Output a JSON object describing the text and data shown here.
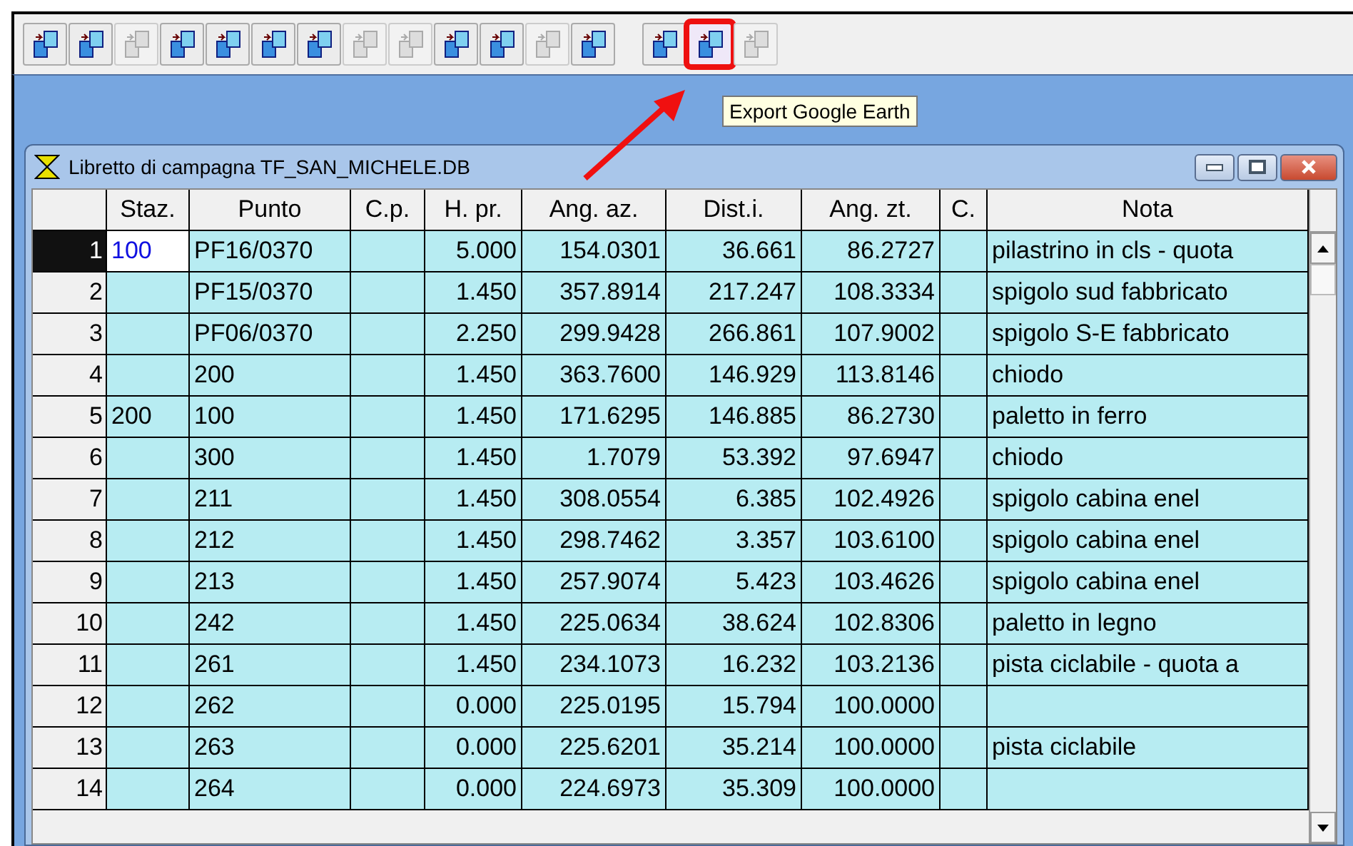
{
  "toolbar": {
    "buttons": [
      {
        "disabled": false,
        "highlighted": false
      },
      {
        "disabled": false,
        "highlighted": false
      },
      {
        "disabled": true,
        "highlighted": false
      },
      {
        "disabled": false,
        "highlighted": false
      },
      {
        "disabled": false,
        "highlighted": false
      },
      {
        "disabled": false,
        "highlighted": false
      },
      {
        "disabled": false,
        "highlighted": false
      },
      {
        "disabled": true,
        "highlighted": false
      },
      {
        "disabled": true,
        "highlighted": false
      },
      {
        "disabled": false,
        "highlighted": false
      },
      {
        "disabled": false,
        "highlighted": false
      },
      {
        "disabled": true,
        "highlighted": false
      },
      {
        "disabled": false,
        "highlighted": false
      },
      {
        "disabled": false,
        "highlighted": false,
        "group_start": true
      },
      {
        "disabled": false,
        "highlighted": true
      },
      {
        "disabled": true,
        "highlighted": false
      }
    ]
  },
  "tooltip": "Export Google Earth",
  "window": {
    "title": "Libretto di campagna TF_SAN_MICHELE.DB"
  },
  "table": {
    "columns": [
      {
        "label": "Staz.",
        "kind": "text"
      },
      {
        "label": "Punto",
        "kind": "text"
      },
      {
        "label": "C.p.",
        "kind": "text"
      },
      {
        "label": "H. pr.",
        "kind": "number"
      },
      {
        "label": "Ang. az.",
        "kind": "number"
      },
      {
        "label": "Dist.i.",
        "kind": "number"
      },
      {
        "label": "Ang. zt.",
        "kind": "number"
      },
      {
        "label": "C.",
        "kind": "text"
      },
      {
        "label": "Nota",
        "kind": "text"
      }
    ],
    "rows": [
      {
        "num": "1",
        "selected": true,
        "cells": [
          "100",
          "PF16/0370",
          "",
          "5.000",
          "154.0301",
          "36.661",
          "86.2727",
          "",
          "pilastrino in cls - quota"
        ]
      },
      {
        "num": "2",
        "selected": false,
        "cells": [
          "",
          "PF15/0370",
          "",
          "1.450",
          "357.8914",
          "217.247",
          "108.3334",
          "",
          "spigolo sud fabbricato"
        ]
      },
      {
        "num": "3",
        "selected": false,
        "cells": [
          "",
          "PF06/0370",
          "",
          "2.250",
          "299.9428",
          "266.861",
          "107.9002",
          "",
          "spigolo S-E fabbricato"
        ]
      },
      {
        "num": "4",
        "selected": false,
        "cells": [
          "",
          "200",
          "",
          "1.450",
          "363.7600",
          "146.929",
          "113.8146",
          "",
          "chiodo"
        ]
      },
      {
        "num": "5",
        "selected": false,
        "cells": [
          "200",
          "100",
          "",
          "1.450",
          "171.6295",
          "146.885",
          "86.2730",
          "",
          "paletto in ferro"
        ]
      },
      {
        "num": "6",
        "selected": false,
        "cells": [
          "",
          "300",
          "",
          "1.450",
          "1.7079",
          "53.392",
          "97.6947",
          "",
          "chiodo"
        ]
      },
      {
        "num": "7",
        "selected": false,
        "cells": [
          "",
          "211",
          "",
          "1.450",
          "308.0554",
          "6.385",
          "102.4926",
          "",
          "spigolo cabina enel"
        ]
      },
      {
        "num": "8",
        "selected": false,
        "cells": [
          "",
          "212",
          "",
          "1.450",
          "298.7462",
          "3.357",
          "103.6100",
          "",
          "spigolo cabina enel"
        ]
      },
      {
        "num": "9",
        "selected": false,
        "cells": [
          "",
          "213",
          "",
          "1.450",
          "257.9074",
          "5.423",
          "103.4626",
          "",
          "spigolo cabina enel"
        ]
      },
      {
        "num": "10",
        "selected": false,
        "cells": [
          "",
          "242",
          "",
          "1.450",
          "225.0634",
          "38.624",
          "102.8306",
          "",
          "paletto in legno"
        ]
      },
      {
        "num": "11",
        "selected": false,
        "cells": [
          "",
          "261",
          "",
          "1.450",
          "234.1073",
          "16.232",
          "103.2136",
          "",
          "pista ciclabile - quota a"
        ]
      },
      {
        "num": "12",
        "selected": false,
        "cells": [
          "",
          "262",
          "",
          "0.000",
          "225.0195",
          "15.794",
          "100.0000",
          "",
          ""
        ]
      },
      {
        "num": "13",
        "selected": false,
        "cells": [
          "",
          "263",
          "",
          "0.000",
          "225.6201",
          "35.214",
          "100.0000",
          "",
          "pista ciclabile"
        ]
      },
      {
        "num": "14",
        "selected": false,
        "cells": [
          "",
          "264",
          "",
          "0.000",
          "224.6973",
          "35.309",
          "100.0000",
          "",
          ""
        ]
      }
    ]
  }
}
